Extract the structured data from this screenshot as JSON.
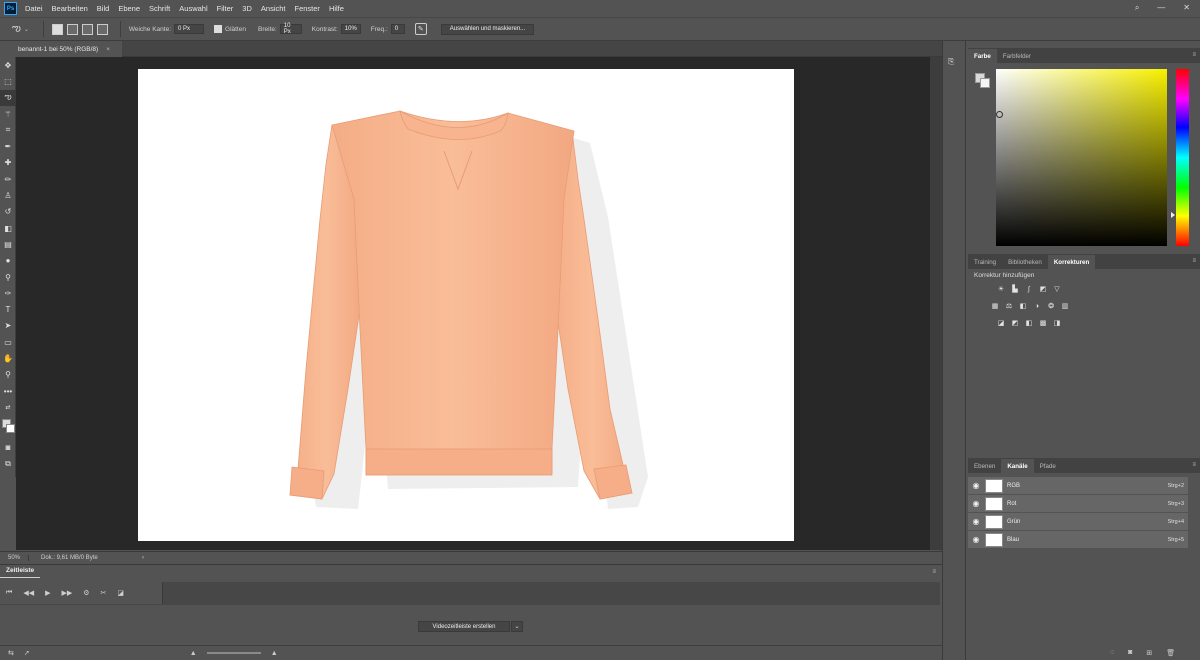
{
  "app": {
    "logo": "Ps"
  },
  "menu": [
    "Datei",
    "Bearbeiten",
    "Bild",
    "Ebene",
    "Schrift",
    "Auswahl",
    "Filter",
    "3D",
    "Ansicht",
    "Fenster",
    "Hilfe"
  ],
  "window_controls": [
    "search-icon",
    "minimize-icon",
    "close-icon"
  ],
  "options": {
    "feather_label": "Weiche Kante:",
    "feather_value": "0 Px",
    "antialias_label": "Glätten",
    "width_label": "Breite:",
    "width_value": "10 Px",
    "contrast_label": "Kontrast:",
    "contrast_value": "10%",
    "freq_label": "Freq.:",
    "freq_value": "0",
    "select_mask_label": "Auswählen und maskieren..."
  },
  "document_tab": {
    "title": "benannt-1 bei 50% (RGB/8)",
    "close": "×"
  },
  "status": {
    "zoom": "50%",
    "doc": "Dok.: 9,61 MB/0 Byte",
    "arrow": "›"
  },
  "timeline": {
    "tab": "Zeitleiste",
    "create_label": "Videozeitleiste erstellen",
    "dropdown": "⌄"
  },
  "color_panel": {
    "tabs": [
      "Farbe",
      "Farbfelder"
    ]
  },
  "mid_panel": {
    "tabs": [
      "Training",
      "Bibliotheken",
      "Korrekturen"
    ],
    "adj_title": "Korrektur hinzufügen"
  },
  "channels_panel": {
    "tabs": [
      "Ebenen",
      "Kanäle",
      "Pfade"
    ],
    "channels": [
      {
        "name": "RGB",
        "shortcut": "Strg+2"
      },
      {
        "name": "Rot",
        "shortcut": "Strg+3"
      },
      {
        "name": "Grün",
        "shortcut": "Strg+4"
      },
      {
        "name": "Blau",
        "shortcut": "Strg+5"
      }
    ]
  },
  "colors": {
    "ui_bg": "#535353",
    "canvas_bg": "#282828",
    "sweater": "#f7b892",
    "accent_blue": "#31a8ff"
  }
}
